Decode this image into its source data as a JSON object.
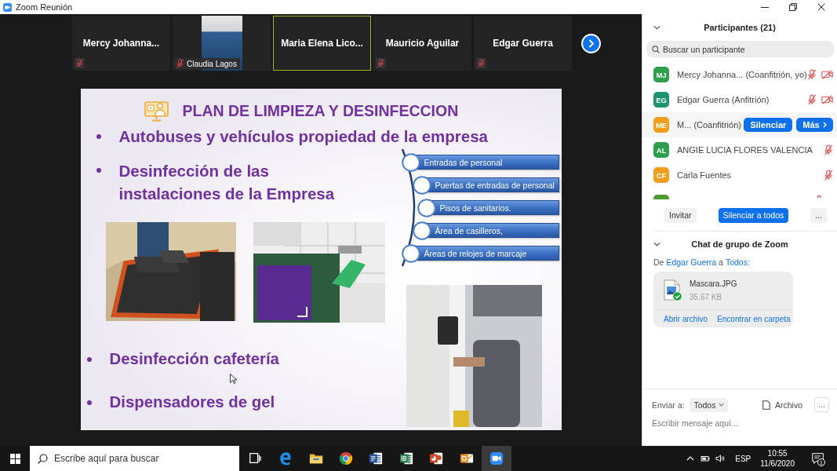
{
  "window": {
    "title": "Zoom Reunión"
  },
  "video_strip": {
    "tiles": [
      {
        "kind": "name",
        "name": "Mercy Johanna...",
        "mic_muted": true,
        "speaking": false
      },
      {
        "kind": "video",
        "name": "Claudia Lagos",
        "mic_muted": true,
        "speaking": false
      },
      {
        "kind": "name",
        "name": "Maria Elena Lico...",
        "mic_muted": false,
        "speaking": true
      },
      {
        "kind": "name",
        "name": "Mauricio Aguilar",
        "mic_muted": true,
        "speaking": false
      },
      {
        "kind": "name",
        "name": "Edgar Guerra",
        "mic_muted": true,
        "speaking": false
      }
    ]
  },
  "slide": {
    "title": "PLAN DE LIMPIEZA Y DESINFECCION",
    "top_bullets": [
      "Autobuses y vehículos propiedad de la empresa",
      "Desinfección de las instalaciones de la Empresa"
    ],
    "diagram_items": [
      "Entradas de personal",
      "Puertas de entradas de personal",
      "Pisos de sanitarios.",
      "Área de casilleros,",
      "Áreas de relojes de marcaje"
    ],
    "bottom_bullets": [
      "Desinfección cafetería",
      "Dispensadores de gel"
    ]
  },
  "participants": {
    "title": "Participantes (21)",
    "search": {
      "placeholder": "Buscar un participante"
    },
    "rows": [
      {
        "initials": "MJ",
        "color": "#2e9f4e",
        "name": "Mercy Johanna... (Coanfitrión, yo)",
        "highlighted": false,
        "mic_muted": true,
        "video_off": true
      },
      {
        "initials": "EG",
        "color": "#1b9470",
        "name": "Edgar Guerra (Anfitrión)",
        "highlighted": false,
        "mic_muted": true,
        "video_off": true
      },
      {
        "initials": "ME",
        "color": "#f29d1c",
        "name": "M... (Coanfitrión)",
        "highlighted": true,
        "buttons": [
          {
            "label": "Silenciar",
            "kind": "primary"
          },
          {
            "label": "Más",
            "kind": "menu"
          }
        ]
      },
      {
        "initials": "AL",
        "color": "#2e9f4e",
        "name": "ANGIE LUCIA FLORES VALENCIA",
        "highlighted": false,
        "mic_muted": true,
        "video_off": false
      },
      {
        "initials": "CF",
        "color": "#f29d1c",
        "name": "Carla Fuentes",
        "highlighted": false,
        "mic_muted": true,
        "video_off": false
      }
    ],
    "partial_row": {
      "color": "#4e9a2e",
      "mic_muted": true
    },
    "buttons": [
      {
        "label": "Invitar",
        "kind": "plain"
      },
      {
        "label": "Silenciar a todos",
        "kind": "primary"
      },
      {
        "label": "...",
        "kind": "plain"
      }
    ]
  },
  "chat": {
    "title": "Chat de grupo de Zoom",
    "message": {
      "from_prefix": "De",
      "sender": "Edgar Guerra",
      "to_prefix": "a",
      "recipient": "Todos:",
      "file": {
        "name": "Mascara.JPG",
        "size": "35.67 KB",
        "downloaded": true,
        "actions": [
          "Abrir archivo",
          "Encontrar en carpeta"
        ]
      }
    },
    "compose": {
      "send_to_label": "Enviar a:",
      "recipient": "Todos",
      "file_button": "Archivo",
      "more": "...",
      "placeholder": "Escribir mensaje aquí..."
    }
  },
  "taskbar": {
    "search": {
      "placeholder": "Escribe aquí para buscar"
    },
    "apps": [
      {
        "kind": "task-view",
        "active": false
      },
      {
        "kind": "edge",
        "active": false
      },
      {
        "kind": "explorer",
        "active": false
      },
      {
        "kind": "chrome",
        "active": false
      },
      {
        "kind": "word",
        "active": false
      },
      {
        "kind": "excel",
        "active": false
      },
      {
        "kind": "powerpoint",
        "active": false
      },
      {
        "kind": "outlook",
        "active": false
      },
      {
        "kind": "zoom",
        "active": true
      }
    ],
    "tray": {
      "language": "ESP",
      "time": "10:55",
      "date": "11/6/2020",
      "notifications": "1"
    }
  }
}
